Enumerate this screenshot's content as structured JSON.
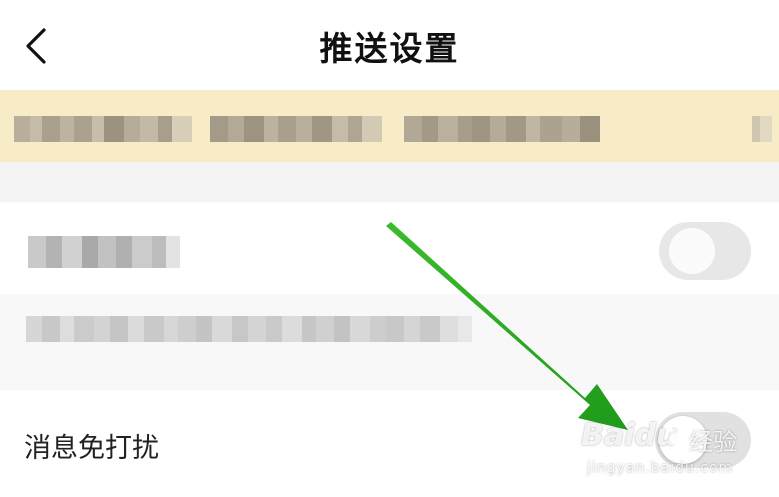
{
  "header": {
    "title": "推送设置"
  },
  "notice": {
    "text_obscured": true
  },
  "settings": {
    "rows": [
      {
        "label_obscured": true
      },
      {
        "label_obscured": true
      },
      {
        "label": "消息免打扰",
        "toggle_on": false
      }
    ]
  },
  "colors": {
    "notice_bg": "#f7ecc7",
    "arrow": "#2aa322",
    "toggle_off": "#e1e1e1"
  },
  "watermark": {
    "brand": "Baidu",
    "suffix": "经验",
    "url": "jingyan.baidu.com"
  }
}
